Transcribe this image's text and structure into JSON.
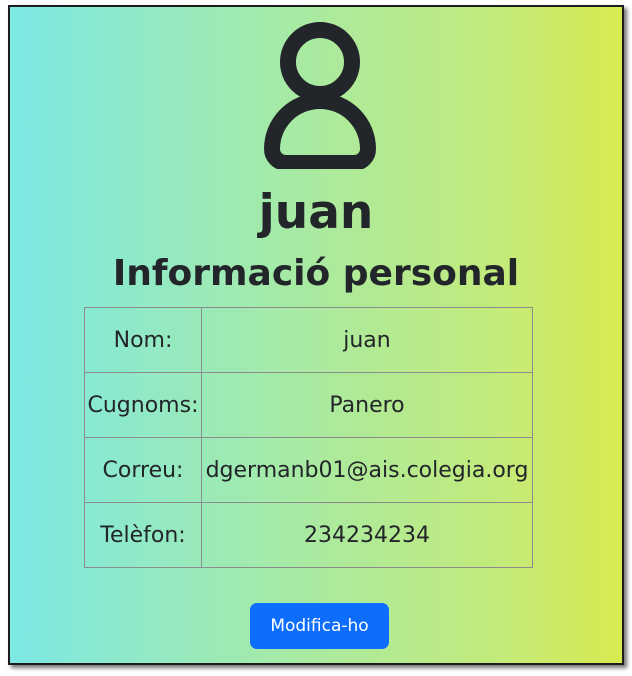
{
  "profile": {
    "username": "juan",
    "section_title": "Informació personal",
    "avatar_icon": "user-icon"
  },
  "info_rows": [
    {
      "label": "Nom:",
      "value": "juan"
    },
    {
      "label": "Cugnoms:",
      "value": "Panero"
    },
    {
      "label": "Correu:",
      "value": "dgermanb01@ais.colegia.org"
    },
    {
      "label": "Telèfon:",
      "value": "234234234"
    }
  ],
  "actions": {
    "edit_label": "Modifica-ho"
  },
  "colors": {
    "gradient_start": "#7de8e4",
    "gradient_end": "#d8ea4f",
    "button": "#0d6efd",
    "text": "#222529"
  }
}
